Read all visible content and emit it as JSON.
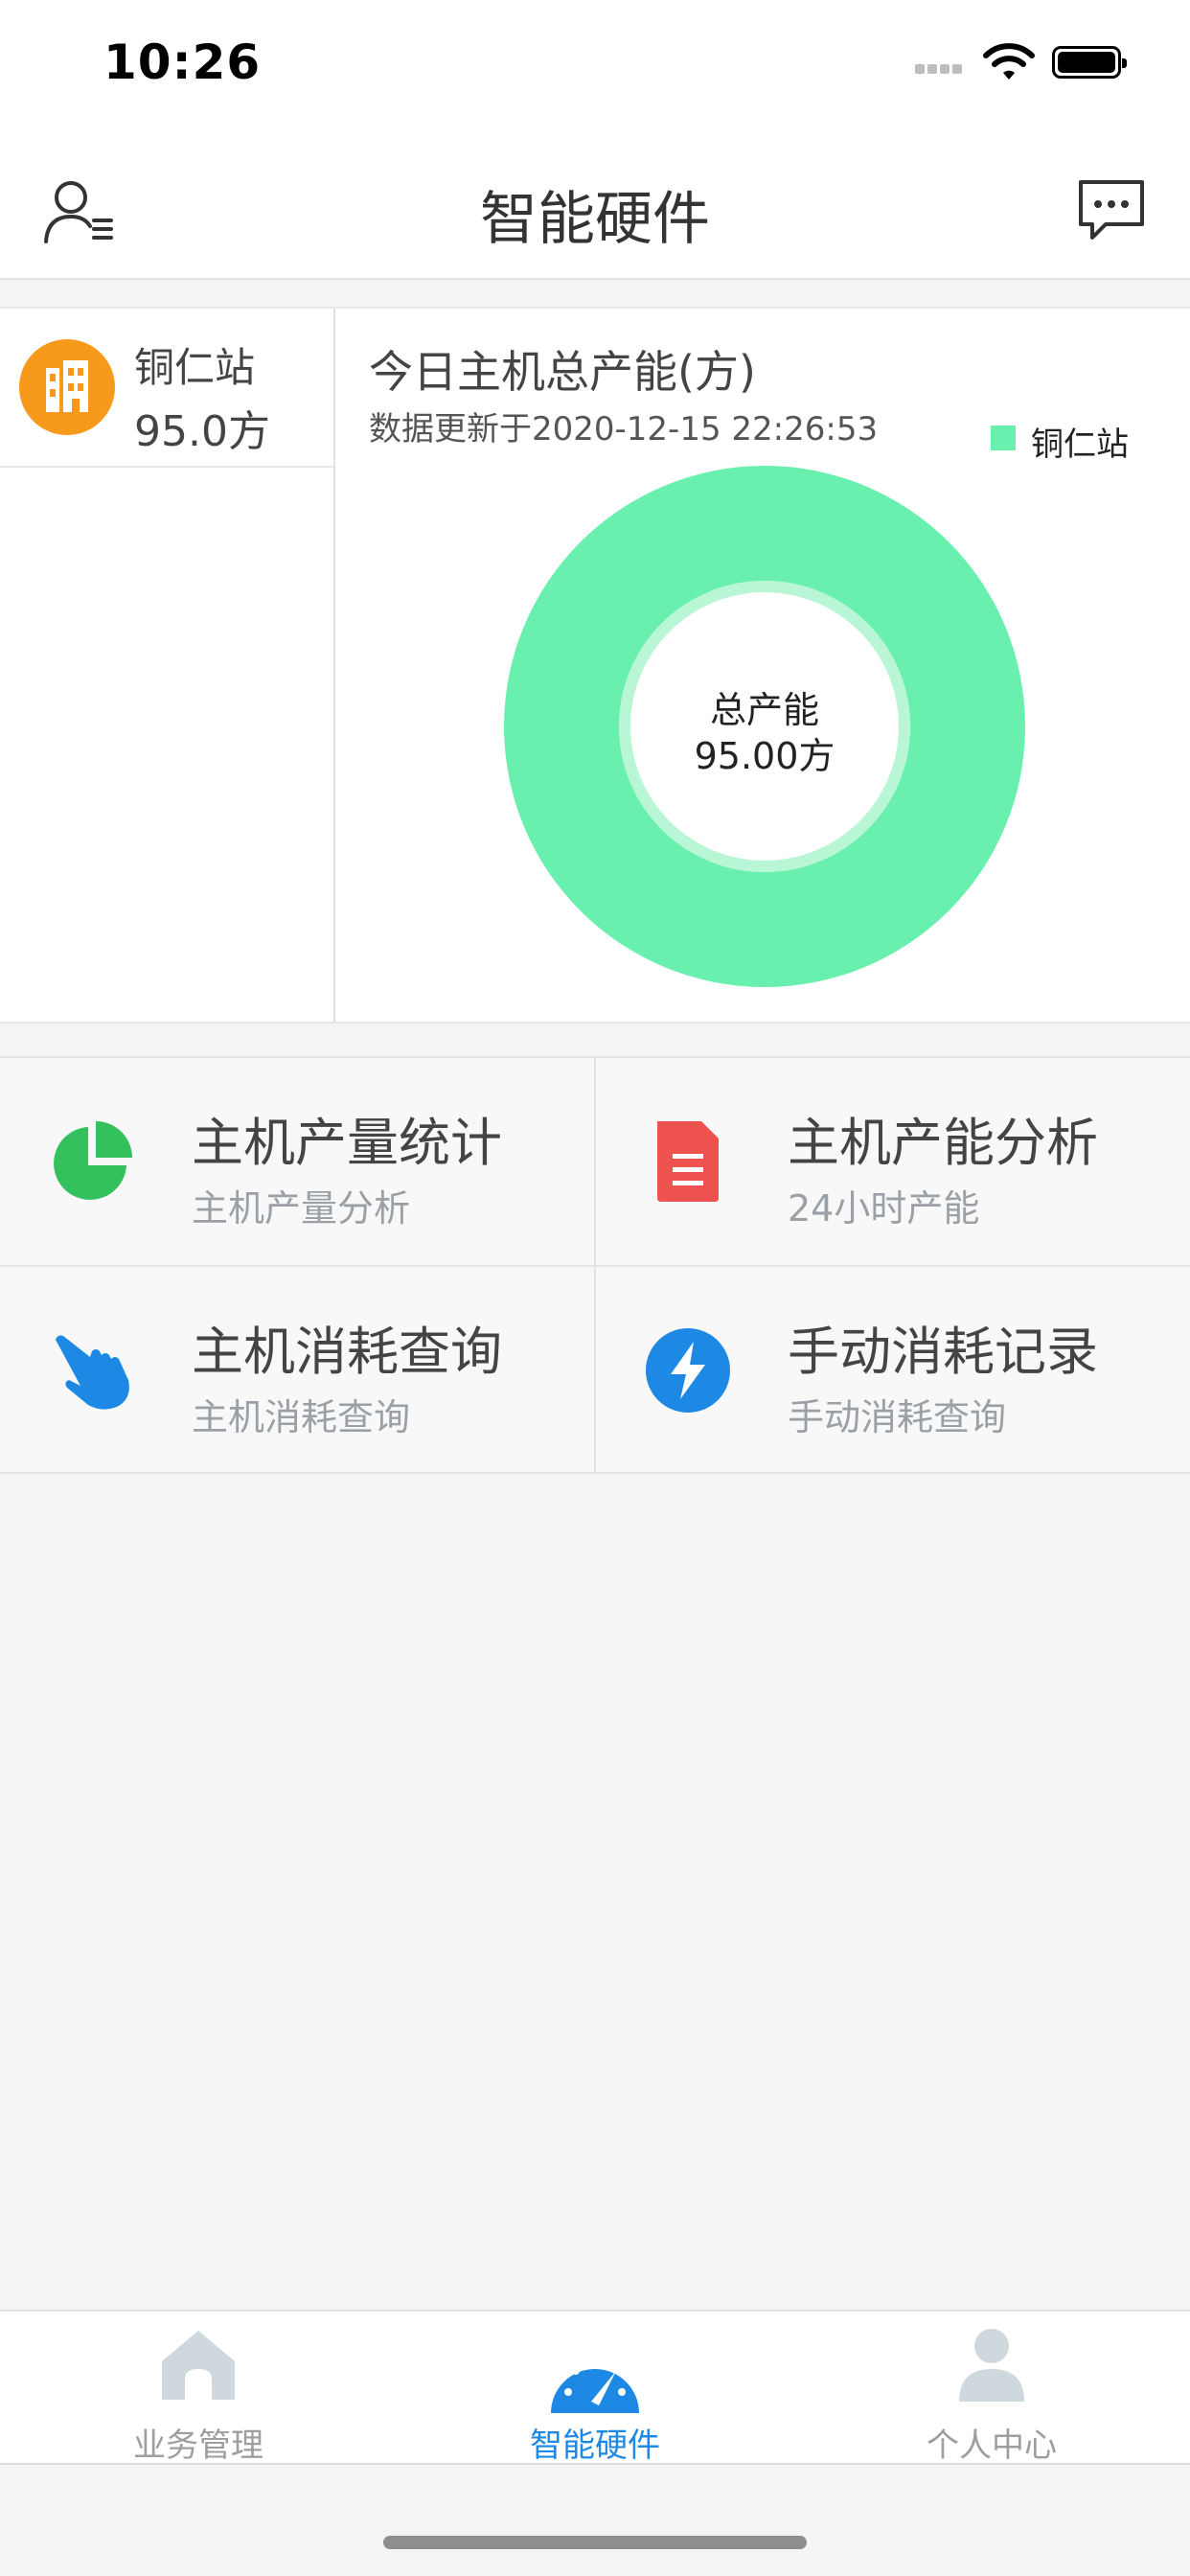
{
  "status_bar": {
    "time": "10:26"
  },
  "nav": {
    "title": "智能硬件"
  },
  "stations": [
    {
      "name": "铜仁站",
      "value": "95.0方"
    }
  ],
  "chart": {
    "title": "今日主机总产能(方)",
    "updated": "数据更新于2020-12-15 22:26:53",
    "legend": "铜仁站",
    "center_label": "总产能",
    "center_value": "95.00方",
    "color": "#69f0ae"
  },
  "chart_data": {
    "type": "pie",
    "title": "今日主机总产能(方)",
    "categories": [
      "铜仁站"
    ],
    "values": [
      95.0
    ],
    "legend": [
      "铜仁站"
    ]
  },
  "menu": [
    {
      "title": "主机产量统计",
      "subtitle": "主机产量分析",
      "icon": "pie-chart-icon",
      "color": "#34c05c"
    },
    {
      "title": "主机产能分析",
      "subtitle": "24小时产能",
      "icon": "document-icon",
      "color": "#ef5350"
    },
    {
      "title": "主机消耗查询",
      "subtitle": "主机消耗查询",
      "icon": "hand-pointer-icon",
      "color": "#1e88e5"
    },
    {
      "title": "手动消耗记录",
      "subtitle": "手动消耗查询",
      "icon": "lightning-icon",
      "color": "#1e88e5"
    }
  ],
  "tabs": [
    {
      "label": "业务管理",
      "icon": "home-icon",
      "active": false
    },
    {
      "label": "智能硬件",
      "icon": "dashboard-gauge-icon",
      "active": true
    },
    {
      "label": "个人中心",
      "icon": "person-icon",
      "active": false
    }
  ]
}
